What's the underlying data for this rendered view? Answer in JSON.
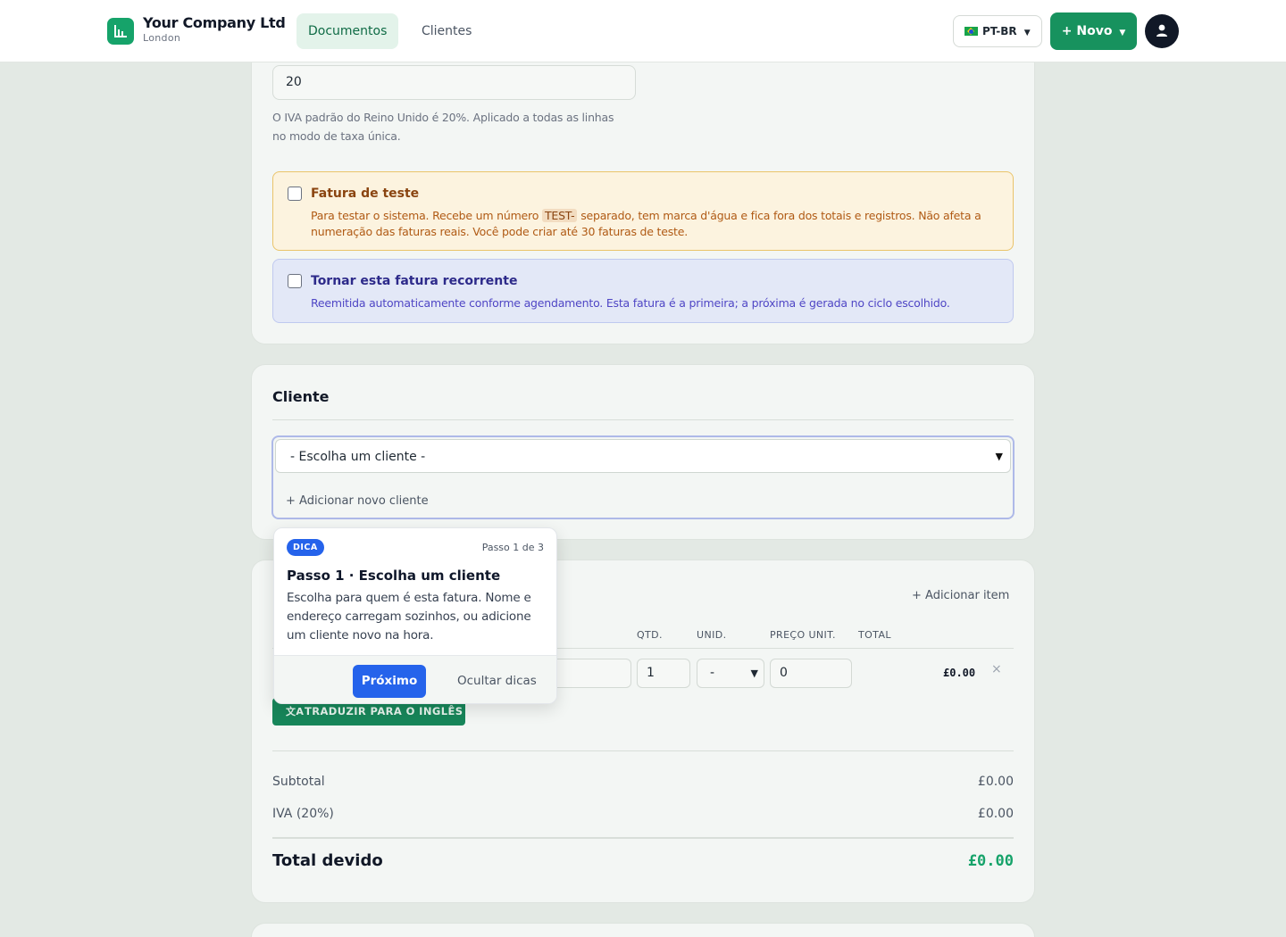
{
  "header": {
    "company_name": "Your Company Ltd",
    "company_city": "London",
    "tabs": [
      {
        "label": "Documentos",
        "active": true
      },
      {
        "label": "Clientes",
        "active": false
      }
    ],
    "language_label": "PT-BR",
    "new_button_label": "+ Novo",
    "logo_icon": "chart-bar-icon",
    "avatar_icon": "user-icon"
  },
  "tax": {
    "rate_value": "20",
    "help_text": "O IVA padrão do Reino Unido é 20%. Aplicado a todas as linhas no modo de taxa única."
  },
  "test_invoice": {
    "title": "Fatura de teste",
    "desc_before": "Para testar o sistema. Recebe um número",
    "code": "TEST-",
    "desc_after": "separado, tem marca d'água e fica fora dos totais e registros. Não afeta a numeração das faturas reais. Você pode criar até 30 faturas de teste."
  },
  "recurring": {
    "title": "Tornar esta fatura recorrente",
    "desc": "Reemitida automaticamente conforme agendamento. Esta fatura é a primeira; a próxima é gerada no ciclo escolhido."
  },
  "client": {
    "section_title": "Cliente",
    "select_value": "- Escolha um cliente -",
    "add_client_label": "+ Adicionar novo cliente"
  },
  "items": {
    "add_item_label": "+ Adicionar item",
    "columns": [
      "QTD.",
      "UNID.",
      "PREÇO UNIT.",
      "TOTAL"
    ],
    "row": {
      "qty": "1",
      "unit": "-",
      "unit_price": "0",
      "total": "£0.00",
      "remove": "×"
    },
    "translate_label": "TRADUZIR PARA O INGLÊS"
  },
  "summary": {
    "subtotal_label": "Subtotal",
    "subtotal_value": "£0.00",
    "vat_label": "IVA (20%)",
    "vat_value": "£0.00",
    "total_label": "Total devido",
    "total_value": "£0.00"
  },
  "tooltip": {
    "badge": "DICA",
    "step": "Passo 1 de 3",
    "title": "Passo 1 · Escolha um cliente",
    "body": "Escolha para quem é esta fatura. Nome e endereço carregam sozinhos, ou adicione um cliente novo na hora.",
    "next_label": "Próximo",
    "hide_label": "Ocultar dicas"
  },
  "colors": {
    "accent": "#17925e",
    "tip_blue": "#2563eb",
    "total_green": "#16a36a"
  }
}
